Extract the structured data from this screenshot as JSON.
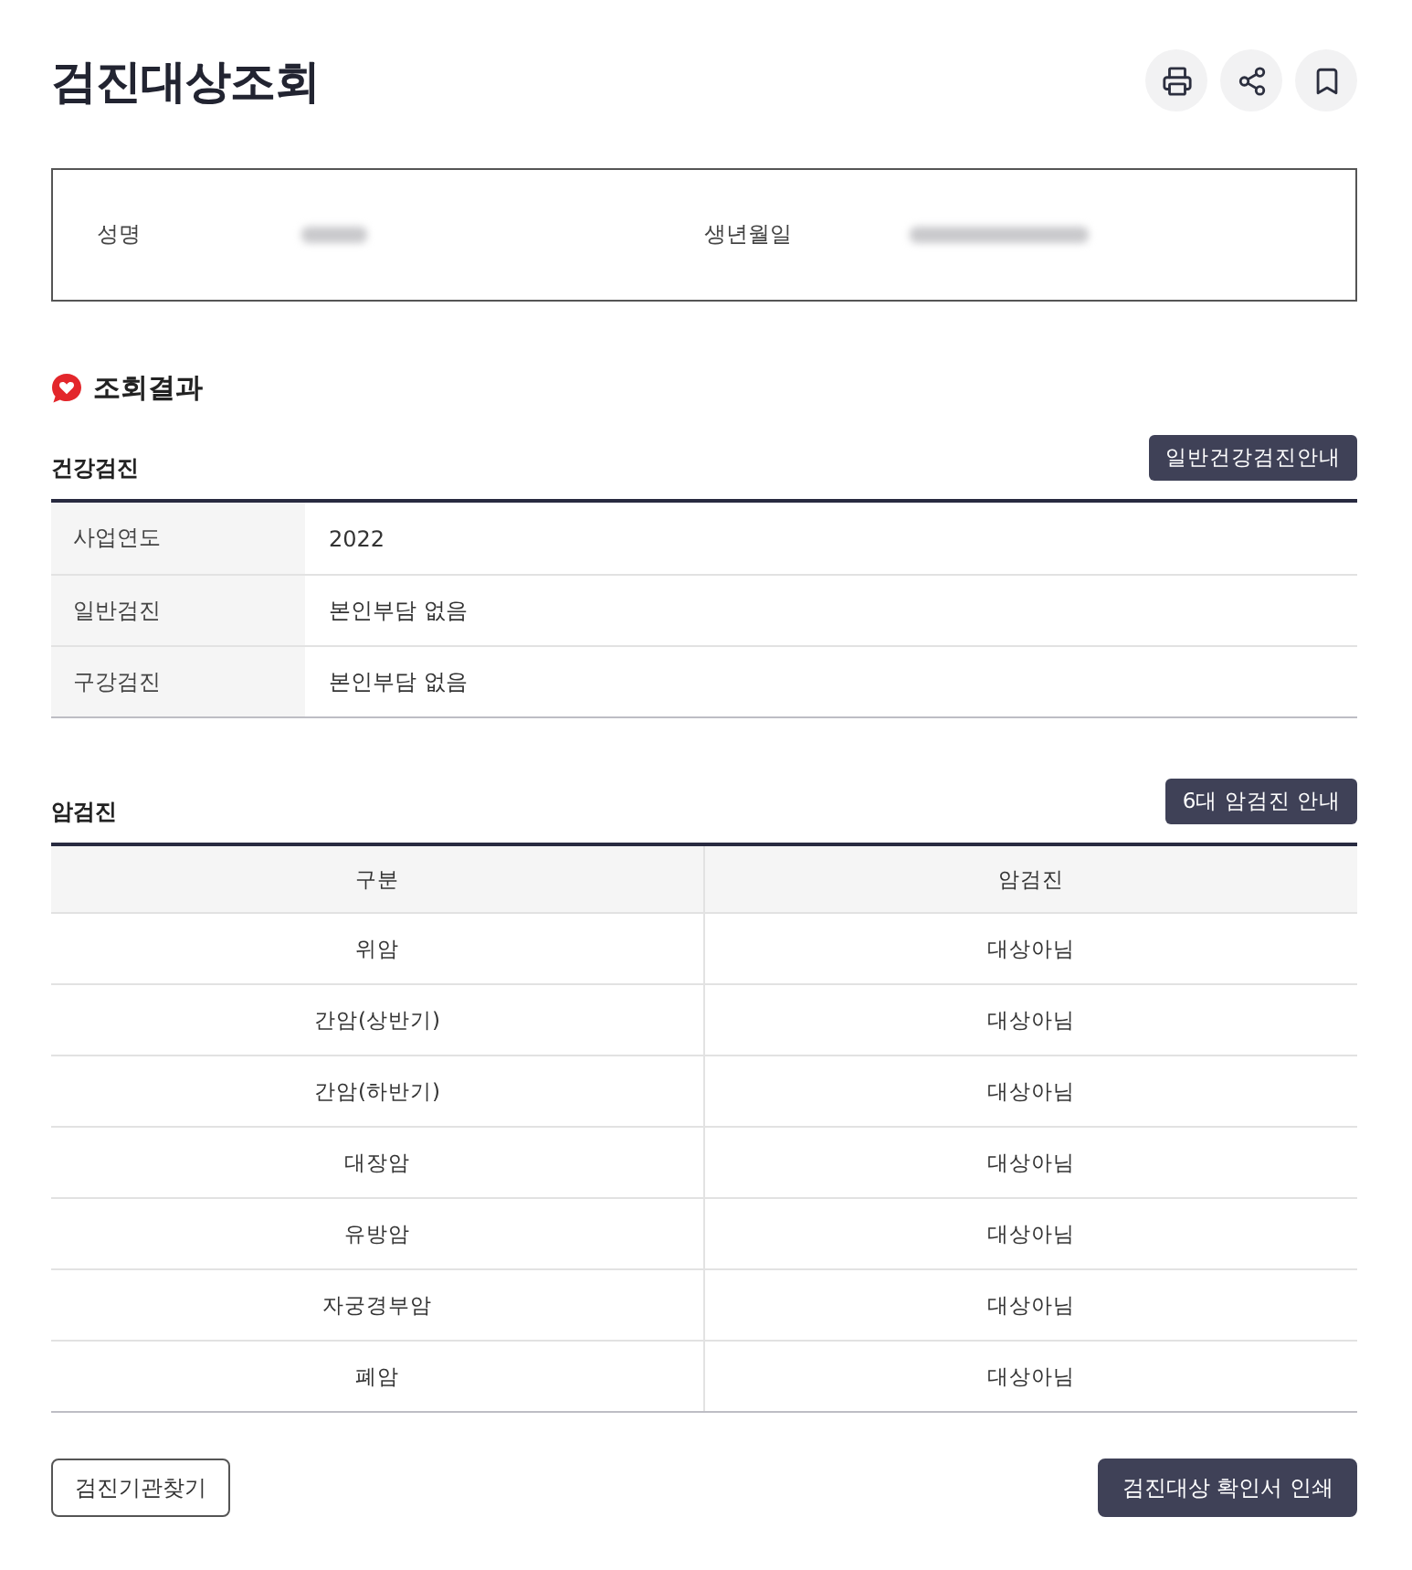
{
  "page": {
    "title": "검진대상조회"
  },
  "toolbar": [
    {
      "kind": "print"
    },
    {
      "kind": "share"
    },
    {
      "kind": "bookmark"
    }
  ],
  "person": {
    "fields": [
      {
        "label": "성명",
        "redacted": true
      },
      {
        "label": "생년월일",
        "redacted": true
      }
    ]
  },
  "results": {
    "title": "조회결과",
    "health_checkup": {
      "title": "건강검진",
      "guide_button": "일반건강검진안내",
      "rows": [
        {
          "label": "사업연도",
          "value": "2022"
        },
        {
          "label": "일반검진",
          "value": "본인부담 없음"
        },
        {
          "label": "구강검진",
          "value": "본인부담 없음"
        }
      ]
    },
    "cancer_checkup": {
      "title": "암검진",
      "guide_button": "6대 암검진 안내",
      "columns": [
        "구분",
        "암검진"
      ],
      "rows": [
        {
          "type": "위암",
          "status": "대상아님"
        },
        {
          "type": "간암(상반기)",
          "status": "대상아님"
        },
        {
          "type": "간암(하반기)",
          "status": "대상아님"
        },
        {
          "type": "대장암",
          "status": "대상아님"
        },
        {
          "type": "유방암",
          "status": "대상아님"
        },
        {
          "type": "자궁경부암",
          "status": "대상아님"
        },
        {
          "type": "폐암",
          "status": "대상아님"
        }
      ]
    }
  },
  "actions": [
    {
      "label": "검진기관찾기",
      "kind": "secondary"
    },
    {
      "label": "검진대상 확인서 인쇄",
      "kind": "primary"
    }
  ]
}
